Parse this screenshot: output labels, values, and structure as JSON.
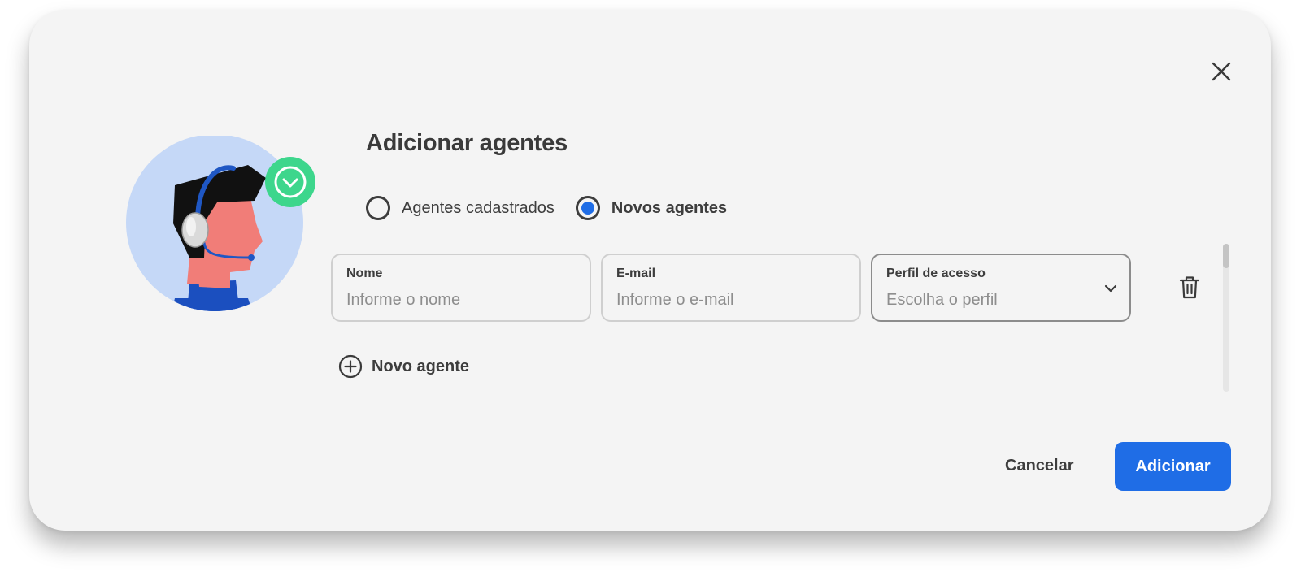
{
  "dialog": {
    "title": "Adicionar agentes",
    "close_icon": "close-icon"
  },
  "illustration": {
    "description_icon": "agent-headset-avatar",
    "badge_icon": "check-circle-icon",
    "colors": {
      "background": "#c5d8f7",
      "badge": "#3dd68c",
      "skin": "#f17d78",
      "hair": "#111111",
      "shirt": "#1b4fbf",
      "headset": "#1f57c4"
    }
  },
  "mode": {
    "options": [
      {
        "label": "Agentes cadastrados",
        "selected": false
      },
      {
        "label": "Novos agentes",
        "selected": true
      }
    ]
  },
  "form": {
    "name": {
      "label": "Nome",
      "placeholder": "Informe o nome"
    },
    "email": {
      "label": "E-mail",
      "placeholder": "Informe o e-mail"
    },
    "profile": {
      "label": "Perfil de acesso",
      "placeholder": "Escolha o perfil"
    },
    "delete_icon": "trash-icon",
    "add_label": "Novo agente",
    "add_icon": "plus-circle-icon"
  },
  "actions": {
    "cancel_label": "Cancelar",
    "submit_label": "Adicionar"
  },
  "colors": {
    "accent": "#1f6de6",
    "surface": "#f4f4f4",
    "text": "#3d3d3d",
    "placeholder": "#8e8e8e"
  }
}
